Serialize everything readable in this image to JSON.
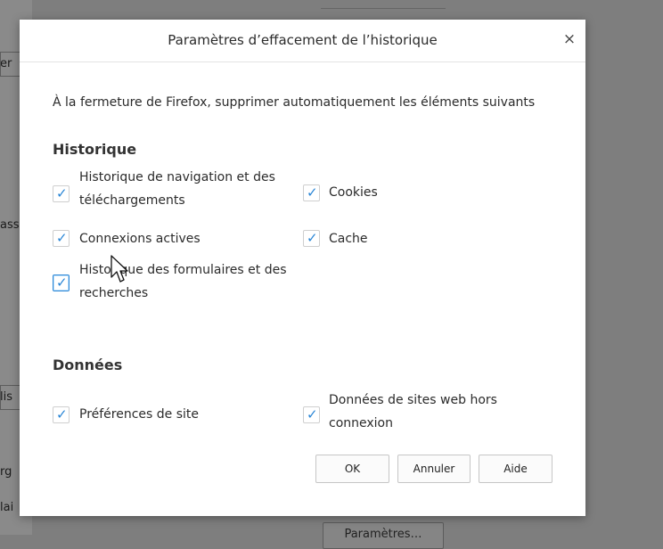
{
  "background": {
    "fragments": [
      "er",
      "ass",
      "lis",
      "rg",
      "lai"
    ],
    "bottom_button": "Paramètres…"
  },
  "dialog": {
    "title": "Paramètres d’effacement de l’historique",
    "close_glyph": "×",
    "intro": "À la fermeture de Firefox, supprimer automatiquement les éléments suivants",
    "sections": {
      "history": {
        "heading": "Historique",
        "items": {
          "browsing_downloads": {
            "line1": "Historique de navigation et des",
            "line2": "téléchargements",
            "checked": true
          },
          "cookies": {
            "label": "Cookies",
            "checked": true
          },
          "active_logins": {
            "label": "Connexions actives",
            "checked": true
          },
          "cache": {
            "label": "Cache",
            "checked": true
          },
          "form_search": {
            "line1": "Historique des formulaires et des",
            "line2": "recherches",
            "checked": true
          }
        }
      },
      "data": {
        "heading": "Données",
        "items": {
          "site_prefs": {
            "label": "Préférences de site",
            "checked": true
          },
          "offline_data": {
            "line1": "Données de sites web hors",
            "line2": "connexion",
            "checked": true
          }
        }
      }
    },
    "buttons": {
      "ok": "OK",
      "cancel": "Annuler",
      "help": "Aide"
    }
  },
  "icons": {
    "check": "checkmark-icon",
    "close": "close-icon",
    "cursor": "mouse-pointer-icon"
  },
  "colors": {
    "accent": "#2a86d6",
    "overlay": "#7e7e7e"
  }
}
